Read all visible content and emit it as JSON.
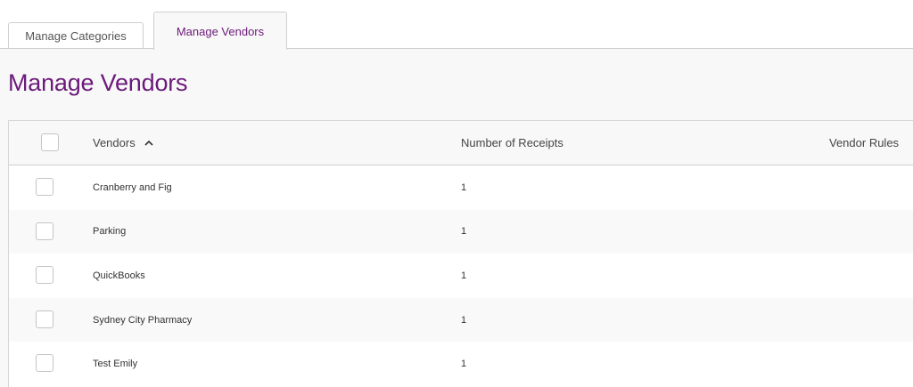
{
  "tabs": [
    {
      "label": "Manage Categories",
      "active": false
    },
    {
      "label": "Manage Vendors",
      "active": true
    }
  ],
  "page_title": "Manage Vendors",
  "table": {
    "columns": {
      "vendors": "Vendors",
      "receipts": "Number of Receipts",
      "rules": "Vendor Rules"
    },
    "sort": {
      "column": "Vendors",
      "direction": "ascending",
      "icon": "chevron-up-icon"
    },
    "rows": [
      {
        "vendor": "Cranberry and Fig",
        "receipts": "1"
      },
      {
        "vendor": "Parking",
        "receipts": "1"
      },
      {
        "vendor": "QuickBooks",
        "receipts": "1"
      },
      {
        "vendor": "Sydney City Pharmacy",
        "receipts": "1"
      },
      {
        "vendor": "Test Emily",
        "receipts": "1"
      }
    ]
  },
  "colors": {
    "accent": "#6b1a7a",
    "border": "#cfcfcf",
    "row_alt": "#f9f9f9"
  }
}
